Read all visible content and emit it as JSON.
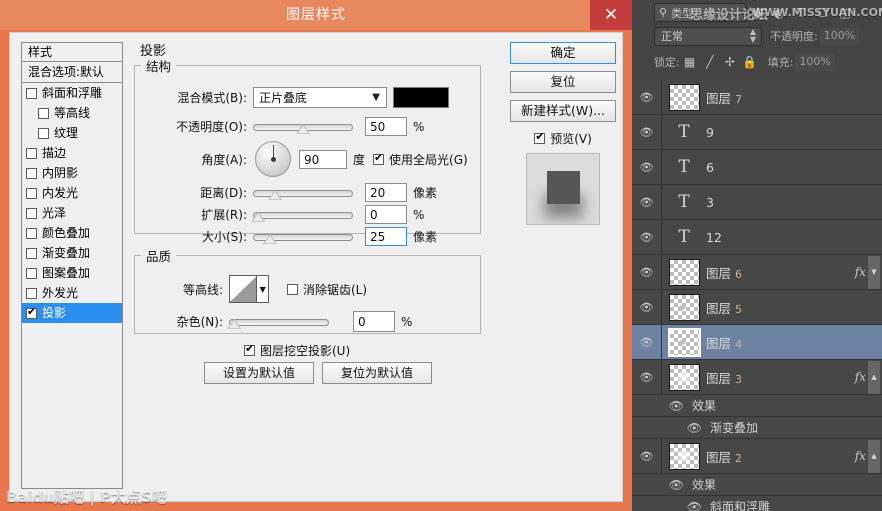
{
  "dialog": {
    "title": "图层样式",
    "close_label": "✕"
  },
  "styles_panel": {
    "header": "样式",
    "blending_options": "混合选项:默认",
    "items": [
      {
        "label": "斜面和浮雕",
        "checked": false,
        "indent": false
      },
      {
        "label": "等高线",
        "checked": false,
        "indent": true
      },
      {
        "label": "纹理",
        "checked": false,
        "indent": true
      },
      {
        "label": "描边",
        "checked": false,
        "indent": false
      },
      {
        "label": "内阴影",
        "checked": false,
        "indent": false
      },
      {
        "label": "内发光",
        "checked": false,
        "indent": false
      },
      {
        "label": "光泽",
        "checked": false,
        "indent": false
      },
      {
        "label": "颜色叠加",
        "checked": false,
        "indent": false
      },
      {
        "label": "渐变叠加",
        "checked": false,
        "indent": false
      },
      {
        "label": "图案叠加",
        "checked": false,
        "indent": false
      },
      {
        "label": "外发光",
        "checked": false,
        "indent": false
      },
      {
        "label": "投影",
        "checked": true,
        "indent": false,
        "selected": true
      }
    ]
  },
  "main": {
    "panel_title": "投影",
    "structure": {
      "legend": "结构",
      "blend_mode_label": "混合模式(B):",
      "blend_mode_value": "正片叠底",
      "blend_mode_color": "#000000",
      "opacity_label": "不透明度(O):",
      "opacity_value": "50",
      "opacity_unit": "%",
      "angle_label": "角度(A):",
      "angle_value": "90",
      "angle_unit": "度",
      "global_light_label": "使用全局光(G)",
      "global_light_checked": true,
      "distance_label": "距离(D):",
      "distance_value": "20",
      "distance_unit": "像素",
      "spread_label": "扩展(R):",
      "spread_value": "0",
      "spread_unit": "%",
      "size_label": "大小(S):",
      "size_value": "25",
      "size_unit": "像素"
    },
    "quality": {
      "legend": "品质",
      "contour_label": "等高线:",
      "antialias_label": "消除锯齿(L)",
      "antialias_checked": false,
      "noise_label": "杂色(N):",
      "noise_value": "0",
      "noise_unit": "%"
    },
    "knockout_label": "图层挖空投影(U)",
    "knockout_checked": true,
    "set_default_button": "设置为默认值",
    "reset_default_button": "复位为默认值"
  },
  "buttons": {
    "ok": "确定",
    "reset": "复位",
    "new_style": "新建样式(W)...",
    "preview_label": "预览(V)",
    "preview_checked": true
  },
  "layers_panel": {
    "filter_placeholder": "类型",
    "filter_icons": [
      "pixel-filter-icon",
      "adjustment-filter-icon",
      "type-filter-icon",
      "shape-filter-icon",
      "smartobject-filter-icon"
    ],
    "blend_mode": "正常",
    "opacity_label": "不透明度:",
    "opacity_value": "100%",
    "lock_label": "锁定:",
    "lock_icons": [
      "lock-transparency-icon",
      "lock-image-icon",
      "lock-position-icon",
      "lock-all-icon"
    ],
    "fill_label": "填充:",
    "fill_value": "100%",
    "layers": [
      {
        "name": "图层",
        "num": "7",
        "type": "raster",
        "visible": true,
        "fx": false,
        "selected": false
      },
      {
        "name": "9",
        "num": "",
        "type": "text",
        "visible": true,
        "fx": false,
        "selected": false
      },
      {
        "name": "6",
        "num": "",
        "type": "text",
        "visible": true,
        "fx": false,
        "selected": false
      },
      {
        "name": "3",
        "num": "",
        "type": "text",
        "visible": true,
        "fx": false,
        "selected": false
      },
      {
        "name": "12",
        "num": "",
        "type": "text",
        "visible": true,
        "fx": false,
        "selected": false
      },
      {
        "name": "图层",
        "num": "6",
        "type": "raster",
        "visible": true,
        "fx": true,
        "selected": false
      },
      {
        "name": "图层",
        "num": "5",
        "type": "raster",
        "visible": true,
        "fx": false,
        "selected": false
      },
      {
        "name": "图层",
        "num": "4",
        "type": "raster",
        "visible": true,
        "fx": false,
        "selected": true
      },
      {
        "name": "图层",
        "num": "3",
        "type": "raster",
        "visible": true,
        "fx": true,
        "selected": false,
        "effects": {
          "label": "效果",
          "items": [
            "渐变叠加"
          ]
        }
      },
      {
        "name": "图层",
        "num": "2",
        "type": "raster",
        "visible": true,
        "fx": true,
        "selected": false,
        "effects": {
          "label": "效果",
          "items": [
            "斜面和浮雕"
          ]
        }
      }
    ]
  },
  "watermarks": {
    "forum": "思缘设计论坛",
    "site": "WWW.MISSYUAN.COM",
    "baidu": "Baidu贴吧 | P大点S吧"
  }
}
